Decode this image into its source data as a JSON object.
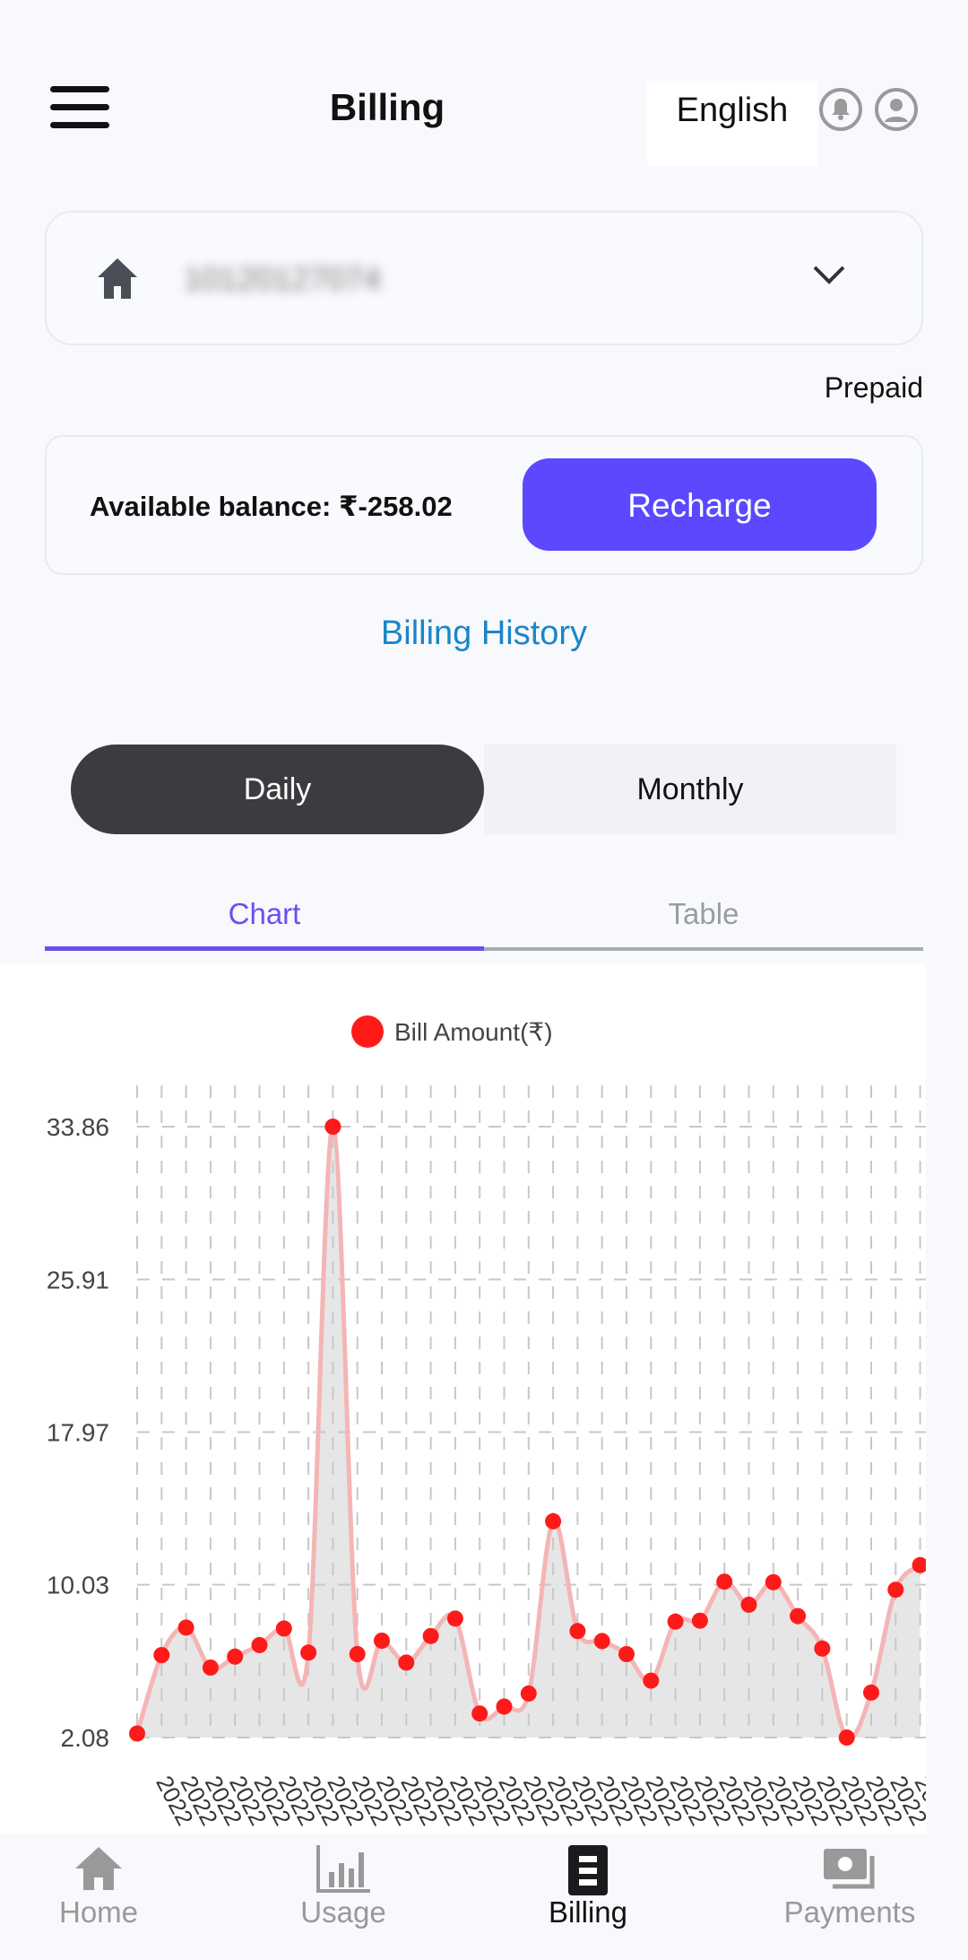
{
  "header": {
    "title": "Billing",
    "language": "English",
    "icons": [
      "menu-icon",
      "bell-icon",
      "user-icon"
    ]
  },
  "account": {
    "number": "10120127074",
    "type": "Prepaid",
    "icon": "home-icon"
  },
  "balance": {
    "text": "Available balance: ₹-258.02",
    "recharge_label": "Recharge"
  },
  "billing_history_label": "Billing History",
  "period_toggle": {
    "options": [
      "Daily",
      "Monthly"
    ],
    "selected": "Daily"
  },
  "view_tabs": {
    "options": [
      "Chart",
      "Table"
    ],
    "selected": "Chart"
  },
  "colors": {
    "accent": "#5b48ff",
    "tab_active": "#6a4ff0",
    "series": "#ff1a1a",
    "link": "#1a86c8"
  },
  "chart_data": {
    "type": "area",
    "legend": {
      "label": "Bill Amount(₹)",
      "placement": "top"
    },
    "y_ticks": [
      "33.86",
      "25.91",
      "17.97",
      "10.03",
      "2.08"
    ],
    "ylim": [
      2.08,
      33.86
    ],
    "x_tick_label": "2022",
    "grid": true,
    "series": [
      {
        "name": "Bill Amount(₹)",
        "values": [
          2.29,
          6.37,
          7.8,
          5.72,
          6.29,
          6.89,
          7.75,
          6.5,
          33.86,
          6.42,
          7.12,
          5.98,
          7.36,
          8.27,
          3.33,
          3.69,
          4.37,
          13.33,
          7.62,
          7.1,
          6.42,
          5.04,
          8.11,
          8.16,
          10.19,
          8.99,
          10.16,
          8.4,
          6.71,
          2.08,
          4.42,
          9.77,
          11.05
        ]
      }
    ]
  },
  "bottom_nav": [
    {
      "label": "Home",
      "icon": "home-icon",
      "active": false
    },
    {
      "label": "Usage",
      "icon": "bar-chart-icon",
      "active": false
    },
    {
      "label": "Billing",
      "icon": "bill-icon",
      "active": true
    },
    {
      "label": "Payments",
      "icon": "cash-icon",
      "active": false
    }
  ]
}
